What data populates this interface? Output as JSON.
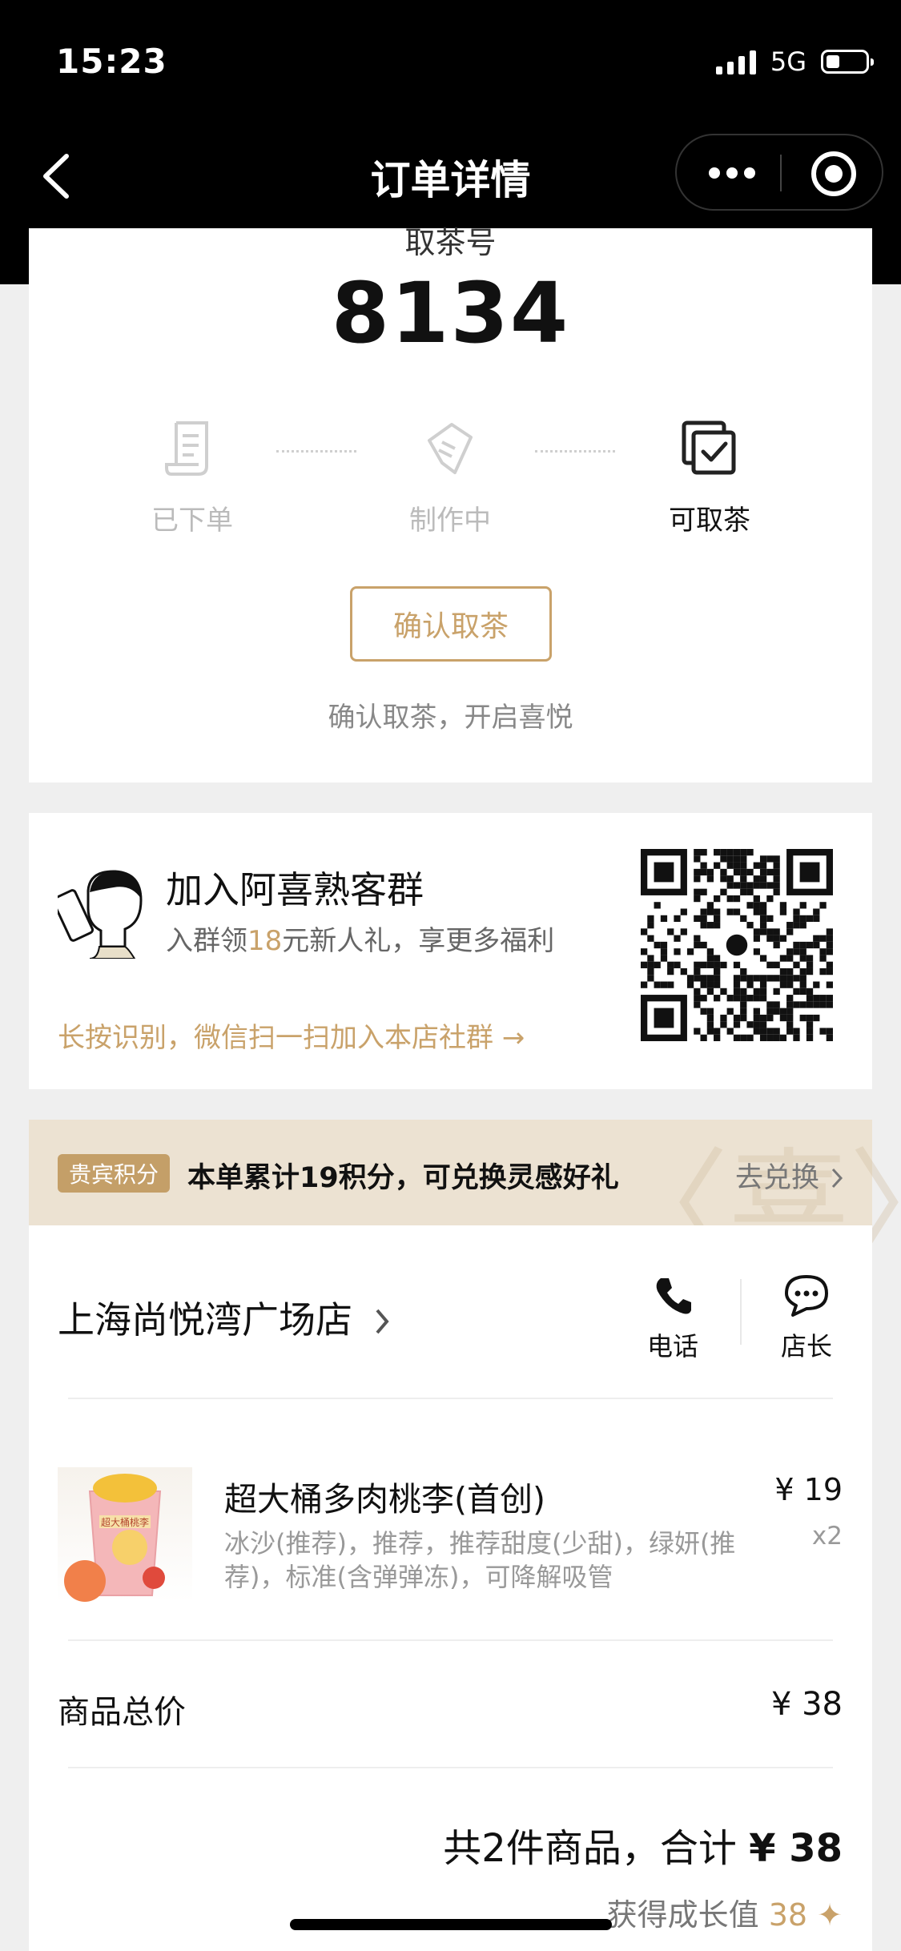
{
  "status_bar": {
    "time": "15:23",
    "network": "5G"
  },
  "nav": {
    "title": "订单详情"
  },
  "pickup": {
    "label": "取茶号",
    "number": "8134"
  },
  "steps": [
    {
      "label": "已下单",
      "state": "done",
      "icon": "receipt-icon"
    },
    {
      "label": "制作中",
      "state": "done",
      "icon": "making-icon"
    },
    {
      "label": "可取茶",
      "state": "active",
      "icon": "checked-box-icon"
    }
  ],
  "confirm": {
    "button": "确认取茶",
    "hint": "确认取茶，开启喜悦"
  },
  "group": {
    "title": "加入阿喜熟客群",
    "sub_prefix": "入群领",
    "sub_highlight": "18",
    "sub_suffix": "元新人礼，享更多福利",
    "link": "长按识别，微信扫一扫加入本店社群 →"
  },
  "points": {
    "tag": "贵宾积分",
    "text": "本单累计19积分，可兑换灵感好礼",
    "action": "去兑换",
    "deco": "〈喜〉"
  },
  "store": {
    "name": "上海尚悦湾广场店",
    "phone_label": "电话",
    "manager_label": "店长"
  },
  "product": {
    "name": "超大桶多肉桃李(首创)",
    "desc": "冰沙(推荐)，推荐，推荐甜度(少甜)，绿妍(推荐)，标准(含弹弹冻)，可降解吸管",
    "price": "¥ 19",
    "qty": "x2",
    "cup_label": "超大桶桃李"
  },
  "summary": {
    "subtotal_label": "商品总价",
    "subtotal": "¥ 38",
    "total_prefix": "共2件商品，合计",
    "total": "¥ 38",
    "growth_label": "获得成长值",
    "growth_value": "38",
    "growth_icon": "✦"
  },
  "colors": {
    "accent": "#c9a26a",
    "points_bg": "#ece2d2",
    "topbar": "#000000"
  }
}
